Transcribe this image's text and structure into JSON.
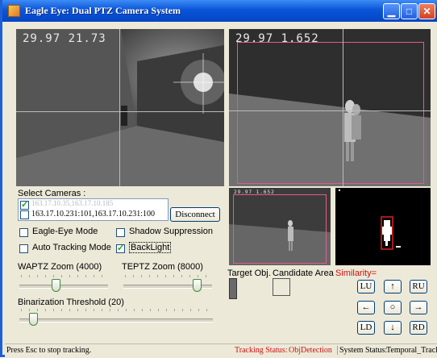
{
  "window": {
    "title": "Eagle Eye: Dual PTZ Camera System"
  },
  "left_video": {
    "osd": "29.97  21.73"
  },
  "right_video": {
    "osd": "29.97  1.652"
  },
  "thumb_video": {
    "osd": "29.97  1.652"
  },
  "cameras": {
    "label": "Select Cameras :",
    "items": [
      {
        "text": "163.17.10.35,163.17.10.185",
        "checked": true
      },
      {
        "text": "163.17.10.231:101,163.17.10.231:100",
        "checked": false
      }
    ],
    "disconnect_label": "Disconnect"
  },
  "options": {
    "eagle_eye": "Eagle-Eye Mode",
    "auto_tracking": "Auto Tracking Mode",
    "shadow_suppression": "Shadow Suppression",
    "backlight": "BackLight"
  },
  "sliders": {
    "waptz_label": "WAPTZ Zoom (4000)",
    "teptz_label": "TEPTZ Zoom (8000)",
    "binarization_label": "Binarization Threshold (20)"
  },
  "target": {
    "target_label": "Target Obj.",
    "candidate_label": "Candidate Area",
    "similarity_label": "Similarity="
  },
  "ptz": {
    "lu": "LU",
    "up": "↑",
    "ru": "RU",
    "left": "←",
    "center": "○",
    "right": "→",
    "ld": "LD",
    "down": "↓",
    "rd": "RD"
  },
  "status": {
    "hint": "Press Esc to stop tracking.",
    "tracking_status_label": "Tracking Status:",
    "tracking_status_value": "ObjDetection",
    "system_status_label": "System Status:",
    "system_status_value": "Temporal_Track"
  },
  "colors": {
    "titlebar": "#0a55d8",
    "accent_red": "#d01010",
    "tracking_box": "#e65a8c"
  }
}
